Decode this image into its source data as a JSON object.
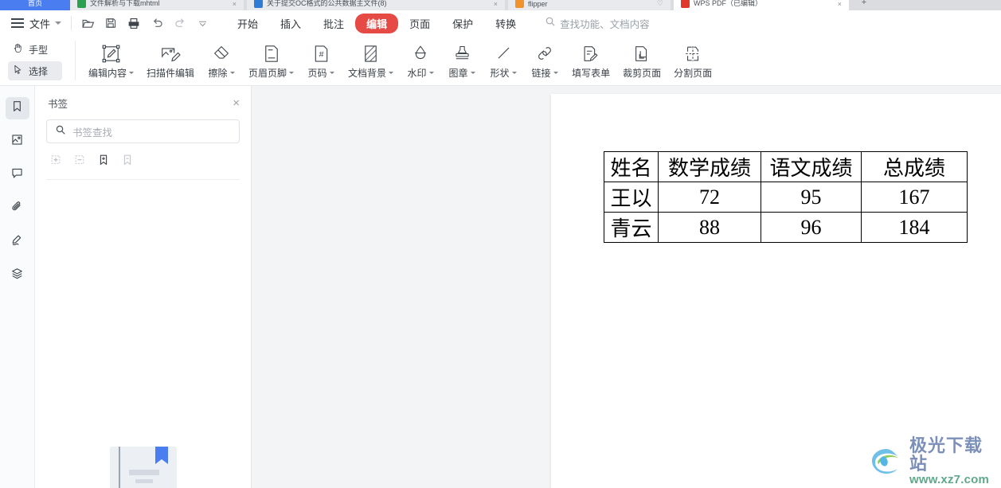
{
  "browser_tabs": {
    "first_tab_label": "首页",
    "new_tab_label": "+",
    "items": [
      {
        "label": "文件解析与下载mhtml",
        "favicon_color": "#2aa14f",
        "close": "×"
      },
      {
        "label": "关于提交OC格式的公共数据主文件(8)",
        "favicon_color": "#2f7bd6",
        "close": "×"
      },
      {
        "label": "flipper",
        "favicon_color": "#f2922c",
        "close": "♡"
      },
      {
        "label": "WPS PDF（已编辑）",
        "favicon_color": "#e0392b",
        "close": "×"
      }
    ]
  },
  "menubar": {
    "file_label": "文件",
    "quick_access": [
      "open-folder-icon",
      "save-icon",
      "print-icon",
      "undo-icon",
      "redo-icon",
      "more-chevron-icon"
    ],
    "tabs": [
      {
        "label": "开始",
        "selected": false
      },
      {
        "label": "插入",
        "selected": false
      },
      {
        "label": "批注",
        "selected": false
      },
      {
        "label": "编辑",
        "selected": true
      },
      {
        "label": "页面",
        "selected": false
      },
      {
        "label": "保护",
        "selected": false
      },
      {
        "label": "转换",
        "selected": false
      }
    ],
    "search_placeholder": "查找功能、文档内容",
    "accent_color": "#e64a45"
  },
  "ribbon": {
    "mode_buttons": [
      {
        "label": "手型",
        "icon": "hand-icon",
        "active": false
      },
      {
        "label": "选择",
        "icon": "cursor-arrow-icon",
        "active": true
      }
    ],
    "items": [
      {
        "label": "编辑内容",
        "icon": "edit-content-icon",
        "dropdown": true
      },
      {
        "label": "扫描件编辑",
        "icon": "scan-edit-icon",
        "dropdown": false
      },
      {
        "label": "擦除",
        "icon": "eraser-icon",
        "dropdown": true
      },
      {
        "label": "页眉页脚",
        "icon": "header-footer-icon",
        "dropdown": true
      },
      {
        "label": "页码",
        "icon": "page-number-icon",
        "dropdown": true
      },
      {
        "label": "文档背景",
        "icon": "document-background-icon",
        "dropdown": true
      },
      {
        "label": "水印",
        "icon": "watermark-icon",
        "dropdown": true
      },
      {
        "label": "图章",
        "icon": "stamp-icon",
        "dropdown": true
      },
      {
        "label": "形状",
        "icon": "shape-line-icon",
        "dropdown": true
      },
      {
        "label": "链接",
        "icon": "link-icon",
        "dropdown": true
      },
      {
        "label": "填写表单",
        "icon": "fill-form-icon",
        "dropdown": false
      },
      {
        "label": "裁剪页面",
        "icon": "crop-page-icon",
        "dropdown": false
      },
      {
        "label": "分割页面",
        "icon": "split-page-icon",
        "dropdown": false
      }
    ]
  },
  "rail": {
    "items": [
      {
        "name": "bookmark-icon",
        "active": true
      },
      {
        "name": "page-thumbnail-icon",
        "active": false
      },
      {
        "name": "comment-icon",
        "active": false
      },
      {
        "name": "attachment-icon",
        "active": false
      },
      {
        "name": "signature-icon",
        "active": false
      },
      {
        "name": "layers-icon",
        "active": false
      }
    ]
  },
  "bookmark_panel": {
    "title": "书签",
    "close_label": "×",
    "search_placeholder": "书签查找",
    "tools": [
      {
        "name": "add-group-icon",
        "disabled": true
      },
      {
        "name": "remove-group-icon",
        "disabled": true
      },
      {
        "name": "add-bookmark-icon",
        "disabled": false
      },
      {
        "name": "delete-bookmark-icon",
        "disabled": true
      }
    ]
  },
  "document": {
    "table": {
      "headers": [
        "姓名",
        "数学成绩",
        "语文成绩",
        "总成绩"
      ],
      "rows": [
        [
          "王以",
          "72",
          "95",
          "167"
        ],
        [
          "青云",
          "88",
          "96",
          "184"
        ]
      ]
    }
  },
  "watermark": {
    "cn_text": "极光下载站",
    "url_text": "www.xz7.com"
  }
}
